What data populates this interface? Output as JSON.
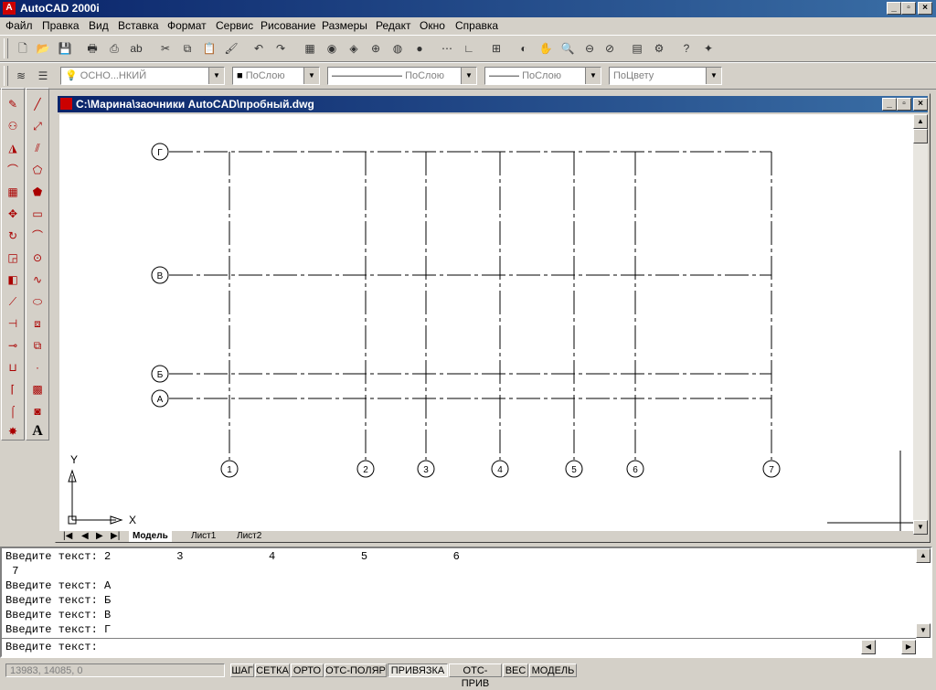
{
  "app": {
    "title": "AutoCAD 2000i"
  },
  "menu": [
    "Файл",
    "Правка",
    "Вид",
    "Вставка",
    "Формат",
    "Сервис",
    "Рисование",
    "Размеры",
    "Редакт",
    "Окно",
    "Справка"
  ],
  "properties": {
    "layer": "ОСНО...НКИЙ",
    "color": "ПоСлою",
    "linetype": "ПоСлою",
    "lineweight": "ПоСлою",
    "plotstyle": "ПоЦвету"
  },
  "drawing": {
    "title": "C:\\Марина\\заочники AutoCAD\\пробный.dwg",
    "row_labels": [
      "Г",
      "В",
      "Б",
      "А"
    ],
    "col_labels": [
      "1",
      "2",
      "3",
      "4",
      "5",
      "6",
      "7"
    ],
    "ucs": {
      "x": "X",
      "y": "Y"
    },
    "tabs": [
      "Модель",
      "Лист1",
      "Лист2"
    ]
  },
  "command": {
    "history": [
      "Введите текст: 2          3             4             5             6",
      " 7",
      "Введите текст: А",
      "Введите текст: Б",
      "Введите текст: В",
      "Введите текст: Г"
    ],
    "prompt": "Введите текст:"
  },
  "status": {
    "coords": "13983, 14085, 0",
    "buttons": [
      {
        "label": "ШАГ",
        "on": false
      },
      {
        "label": "СЕТКА",
        "on": false
      },
      {
        "label": "ОРТО",
        "on": false
      },
      {
        "label": "ОТС-ПОЛЯР",
        "on": false
      },
      {
        "label": "ПРИВЯЗКА",
        "on": true
      },
      {
        "label": "ОТС-ПРИВ",
        "on": false
      },
      {
        "label": "ВЕС",
        "on": false
      },
      {
        "label": "МОДЕЛЬ",
        "on": false
      }
    ]
  }
}
